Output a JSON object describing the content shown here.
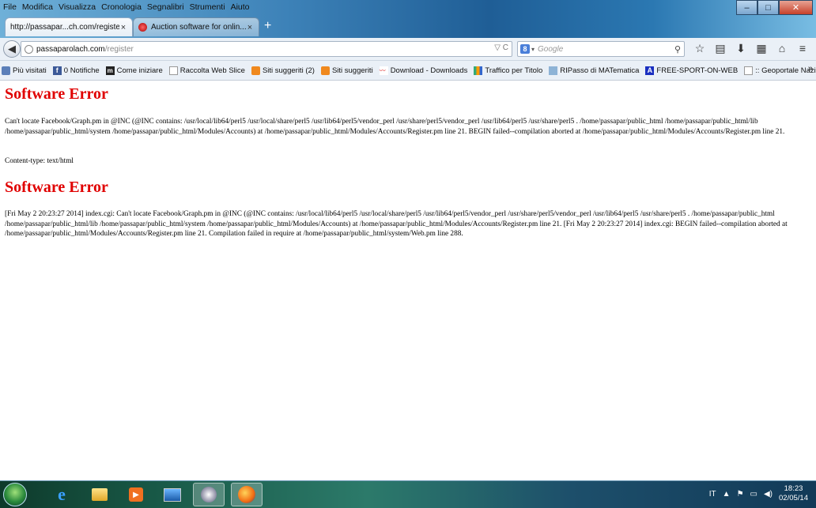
{
  "menu": [
    "File",
    "Modifica",
    "Visualizza",
    "Cronologia",
    "Segnalibri",
    "Strumenti",
    "Aiuto"
  ],
  "window_controls": {
    "minimize": "–",
    "maximize": "□",
    "close": "✕"
  },
  "tabs": [
    {
      "label": "http://passapar...ch.com/register",
      "close": "×"
    },
    {
      "label": "Auction software for onlin...",
      "close": "×"
    }
  ],
  "new_tab": "+",
  "url": {
    "host": "passaparolach.com",
    "path": "/register",
    "right_glyphs": "▽ C"
  },
  "search": {
    "engine_badge": "8",
    "placeholder": "Google"
  },
  "bookmarks": [
    {
      "label": "Più visitati",
      "icon": "firefox-folder-icon"
    },
    {
      "label": "0 Notifiche",
      "icon": "facebook-icon"
    },
    {
      "label": "Come iniziare",
      "icon": "mozilla-icon"
    },
    {
      "label": "Raccolta Web Slice",
      "icon": "blank-page-icon"
    },
    {
      "label": "Siti suggeriti (2)",
      "icon": "suggested-sites-icon"
    },
    {
      "label": "Siti suggeriti",
      "icon": "suggested-sites-icon"
    },
    {
      "label": "Download - Downloads",
      "icon": "wave-icon"
    },
    {
      "label": "Traffico per Titolo",
      "icon": "bars-chart-icon"
    },
    {
      "label": "RIPasso di MATematica",
      "icon": "image-icon"
    },
    {
      "label": "FREE-SPORT-ON-WEB",
      "icon": "a-logo-icon"
    },
    {
      "label": ":: Geoportale Nazional...",
      "icon": "blank-page-icon"
    }
  ],
  "bookmarks_overflow": "»",
  "page": {
    "title1": "Software Error",
    "error1": "Can't locate Facebook/Graph.pm in @INC (@INC contains: /usr/local/lib64/perl5 /usr/local/share/perl5 /usr/lib64/perl5/vendor_perl /usr/share/perl5/vendor_perl /usr/lib64/perl5 /usr/share/perl5 . /home/passapar/public_html /home/passapar/public_html/lib /home/passapar/public_html/system /home/passapar/public_html/Modules/Accounts) at /home/passapar/public_html/Modules/Accounts/Register.pm line 21. BEGIN failed--compilation aborted at /home/passapar/public_html/Modules/Accounts/Register.pm line 21.",
    "content_type": "Content-type: text/html",
    "title2": "Software Error",
    "error2": "[Fri May 2 20:23:27 2014] index.cgi: Can't locate Facebook/Graph.pm in @INC (@INC contains: /usr/local/lib64/perl5 /usr/local/share/perl5 /usr/lib64/perl5/vendor_perl /usr/share/perl5/vendor_perl /usr/lib64/perl5 /usr/share/perl5 . /home/passapar/public_html /home/passapar/public_html/lib /home/passapar/public_html/system /home/passapar/public_html/Modules/Accounts) at /home/passapar/public_html/Modules/Accounts/Register.pm line 21. [Fri May 2 20:23:27 2014] index.cgi: BEGIN failed--compilation aborted at /home/passapar/public_html/Modules/Accounts/Register.pm line 21. Compilation failed in require at /home/passapar/public_html/system/Web.pm line 288."
  },
  "taskbar": {
    "media_glyph": "▶",
    "language": "IT",
    "tray_arrow": "▲",
    "time": "18:23",
    "date": "02/05/14"
  }
}
